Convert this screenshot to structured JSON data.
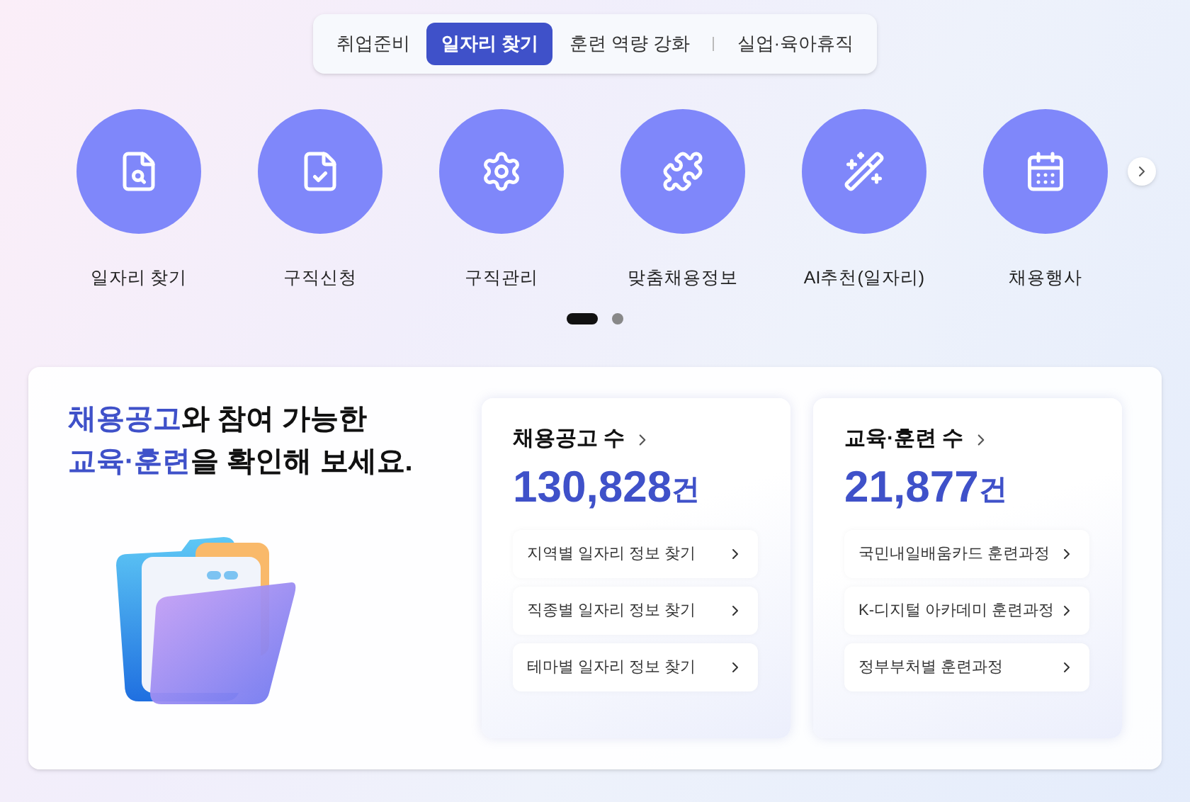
{
  "tabs": [
    {
      "label": "취업준비",
      "selected": false
    },
    {
      "label": "일자리 찾기",
      "selected": true
    },
    {
      "label": "훈련 역량 강화",
      "selected": false
    },
    {
      "label": "실업·육아휴직",
      "selected": false
    }
  ],
  "shortcuts": [
    {
      "label": "일자리 찾기"
    },
    {
      "label": "구직신청"
    },
    {
      "label": "구직관리"
    },
    {
      "label": "맞춤채용정보"
    },
    {
      "label": "AI추천(일자리)"
    },
    {
      "label": "채용행사"
    }
  ],
  "carousel_dots": [
    {
      "selected": true
    },
    {
      "selected": false
    }
  ],
  "headline": [
    [
      {
        "text": "채용공고",
        "highlight": true
      },
      {
        "text": "와 참여 가능한",
        "highlight": false
      }
    ],
    [
      {
        "text": "교육·훈련",
        "highlight": true
      },
      {
        "text": "을 확인해 보세요.",
        "highlight": false
      }
    ]
  ],
  "stat_cards": [
    {
      "title": "채용공고 수",
      "count": "130,828",
      "unit": "건",
      "links": [
        "지역별 일자리 정보 찾기",
        "직종별 일자리 정보 찾기",
        "테마별 일자리 정보 찾기"
      ]
    },
    {
      "title": "교육·훈련 수",
      "count": "21,877",
      "unit": "건",
      "links": [
        "국민내일배움카드 훈련과정",
        "K-디지털 아카데미 훈련과정",
        "정부부처별 훈련과정"
      ]
    }
  ]
}
